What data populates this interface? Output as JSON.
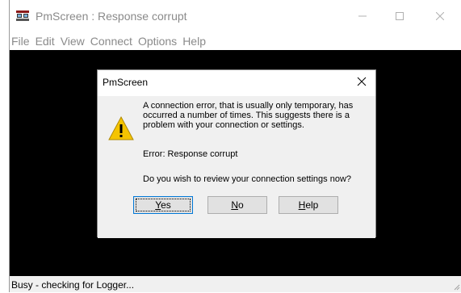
{
  "window": {
    "title": "PmScreen : Response corrupt",
    "app_icon": "pmscreen-app-icon"
  },
  "menu": {
    "items": [
      "File",
      "Edit",
      "View",
      "Connect",
      "Options",
      "Help"
    ]
  },
  "dialog": {
    "title": "PmScreen",
    "icon": "warning-icon",
    "message": "A connection error, that is usually only temporary, has occurred a number of times.  This suggests there is a problem with your connection or settings.",
    "error": "Error:  Response corrupt",
    "question": "Do you wish to review your connection settings now?",
    "buttons": [
      {
        "label": "Yes",
        "accel": "Y"
      },
      {
        "label": "No",
        "accel": "N"
      },
      {
        "label": "Help",
        "accel": "H"
      }
    ]
  },
  "status": {
    "text": "Busy - checking for Logger..."
  },
  "colors": {
    "client_background": "#000000",
    "warning_yellow": "#f5c400",
    "focus_border": "#0078d7"
  }
}
